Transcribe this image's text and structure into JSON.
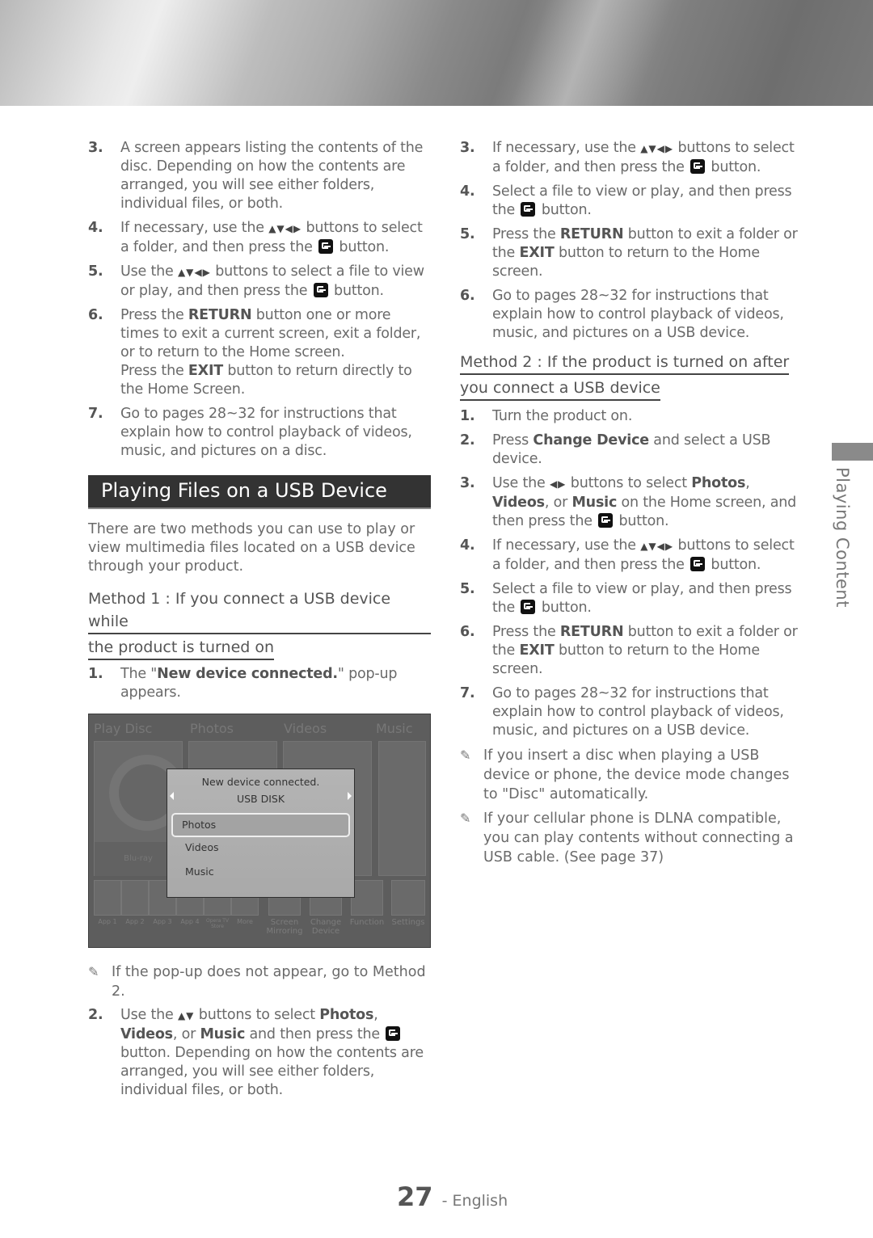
{
  "side_tab": {
    "label": "Playing Content"
  },
  "left": {
    "steps_top": [
      {
        "num": "3.",
        "parts": [
          {
            "t": "A screen appears listing the contents of the disc. Depending on how the contents are arranged, you will see either folders, individual files, or both."
          }
        ]
      },
      {
        "num": "4.",
        "parts": [
          {
            "t": "If necessary, use the "
          },
          {
            "icon": "arrows4"
          },
          {
            "t": " buttons to select a folder, and then press the "
          },
          {
            "icon": "enter"
          },
          {
            "t": " button."
          }
        ]
      },
      {
        "num": "5.",
        "parts": [
          {
            "t": "Use the "
          },
          {
            "icon": "arrows4"
          },
          {
            "t": " buttons to select a file to view or play, and then press the "
          },
          {
            "icon": "enter"
          },
          {
            "t": " button."
          }
        ]
      },
      {
        "num": "6.",
        "parts": [
          {
            "t": "Press the "
          },
          {
            "b": "RETURN"
          },
          {
            "t": " button one or more times to exit a current screen, exit a folder, or to return to the Home screen."
          },
          {
            "br": true
          },
          {
            "t": "Press the "
          },
          {
            "b": "EXIT"
          },
          {
            "t": " button to return directly to the Home Screen."
          }
        ]
      },
      {
        "num": "7.",
        "parts": [
          {
            "t": "Go to pages 28~32 for instructions that explain how to control playback of videos, music, and pictures on a disc."
          }
        ]
      }
    ],
    "section_title": "Playing Files on a USB Device",
    "intro": "There are two methods you can use to play or view multimedia files located on a USB device through your product.",
    "method1_line1": "Method 1 : If you connect a USB device while",
    "method1_line2": "the product is turned on",
    "step1": {
      "num": "1.",
      "parts": [
        {
          "t": "The \""
        },
        {
          "b": "New device connected."
        },
        {
          "t": "\" pop-up appears."
        }
      ]
    },
    "tv": {
      "categories": [
        "Play Disc",
        "Photos",
        "Videos",
        "Music"
      ],
      "disc_label": "Blu-ray",
      "popup_title": "New device connected.",
      "popup_device": "USB DISK",
      "popup_options": [
        "Photos",
        "Videos",
        "Music"
      ],
      "selected_option": "Photos",
      "apps": [
        "App 1",
        "App 2",
        "App 3",
        "App 4",
        "Opera TV Store",
        "More"
      ],
      "functions": [
        "Screen Mirroring",
        "Change Device",
        "Function",
        "Settings"
      ]
    },
    "note1": "If the pop-up does not appear, go to Method 2.",
    "step2": {
      "num": "2.",
      "parts": [
        {
          "t": "Use the "
        },
        {
          "icon": "arrows2"
        },
        {
          "t": " buttons to select "
        },
        {
          "b": "Photos"
        },
        {
          "t": ", "
        },
        {
          "b": "Videos"
        },
        {
          "t": ", or "
        },
        {
          "b": "Music"
        },
        {
          "t": " and then press the "
        },
        {
          "icon": "enter"
        },
        {
          "t": " button. Depending on how the contents are arranged, you will see either folders, individual files, or both."
        }
      ]
    }
  },
  "right": {
    "steps_top": [
      {
        "num": "3.",
        "parts": [
          {
            "t": "If necessary, use the "
          },
          {
            "icon": "arrows4"
          },
          {
            "t": " buttons to select a folder, and then press the "
          },
          {
            "icon": "enter"
          },
          {
            "t": " button."
          }
        ]
      },
      {
        "num": "4.",
        "parts": [
          {
            "t": "Select a file to view or play, and then press the "
          },
          {
            "icon": "enter"
          },
          {
            "t": " button."
          }
        ]
      },
      {
        "num": "5.",
        "parts": [
          {
            "t": "Press the "
          },
          {
            "b": "RETURN"
          },
          {
            "t": " button to exit a folder or the "
          },
          {
            "b": "EXIT"
          },
          {
            "t": " button to return to the Home screen."
          }
        ]
      },
      {
        "num": "6.",
        "parts": [
          {
            "t": "Go to pages 28~32 for instructions that explain how to control playback of videos, music, and pictures on a USB device."
          }
        ]
      }
    ],
    "method2_line1": "Method 2 : If the product is turned on after",
    "method2_line2": "you connect a USB device",
    "steps_method2": [
      {
        "num": "1.",
        "parts": [
          {
            "t": "Turn the product on."
          }
        ]
      },
      {
        "num": "2.",
        "parts": [
          {
            "t": "Press "
          },
          {
            "b": "Change Device"
          },
          {
            "t": " and select a USB device."
          }
        ]
      },
      {
        "num": "3.",
        "parts": [
          {
            "t": "Use the "
          },
          {
            "icon": "arrows2lr"
          },
          {
            "t": " buttons to select "
          },
          {
            "b": "Photos"
          },
          {
            "t": ", "
          },
          {
            "b": "Videos"
          },
          {
            "t": ", or "
          },
          {
            "b": "Music"
          },
          {
            "t": " on the Home screen, and then press the "
          },
          {
            "icon": "enter"
          },
          {
            "t": " button."
          }
        ]
      },
      {
        "num": "4.",
        "parts": [
          {
            "t": "If necessary, use the "
          },
          {
            "icon": "arrows4"
          },
          {
            "t": " buttons to select a folder, and then press the "
          },
          {
            "icon": "enter"
          },
          {
            "t": " button."
          }
        ]
      },
      {
        "num": "5.",
        "parts": [
          {
            "t": "Select a file to view or play, and then press the "
          },
          {
            "icon": "enter"
          },
          {
            "t": " button."
          }
        ]
      },
      {
        "num": "6.",
        "parts": [
          {
            "t": "Press the "
          },
          {
            "b": "RETURN"
          },
          {
            "t": " button to exit a folder or the "
          },
          {
            "b": "EXIT"
          },
          {
            "t": " button to return to the Home screen."
          }
        ]
      },
      {
        "num": "7.",
        "parts": [
          {
            "t": "Go to pages 28~32 for instructions that explain how to control playback of videos, music, and pictures on a USB device."
          }
        ]
      }
    ],
    "notes": [
      "If you insert a disc when playing a USB device or phone, the device mode changes to \"Disc\" automatically.",
      "If your cellular phone is DLNA compatible, you can play contents without connecting a USB cable. (See page 37)"
    ]
  },
  "footer": {
    "page_number": "27",
    "language": "- English"
  },
  "icons": {
    "note": "pencil-note-icon",
    "enter": "enter-button-icon",
    "arrows": "direction-arrows-icon"
  }
}
